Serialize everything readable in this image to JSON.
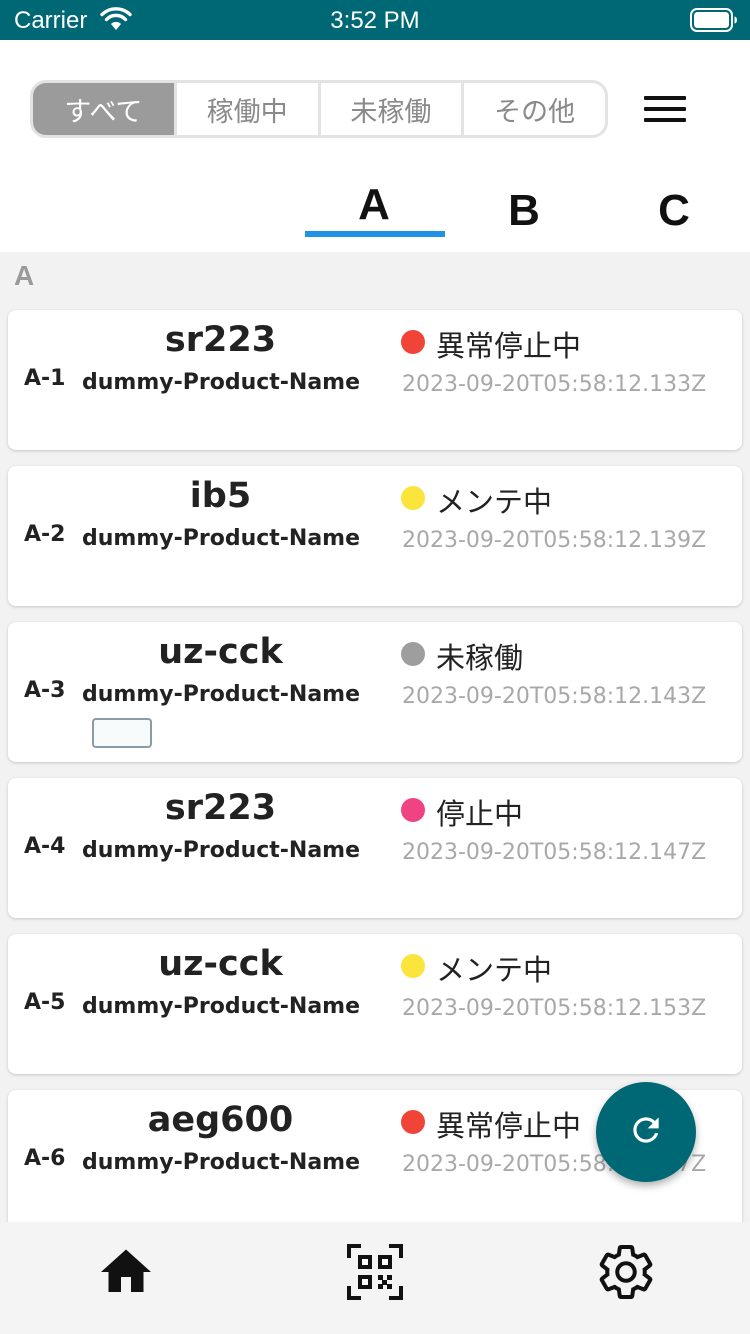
{
  "status_bar": {
    "carrier": "Carrier",
    "time": "3:52 PM",
    "icons": [
      "wifi-icon",
      "battery-icon"
    ]
  },
  "filter": {
    "segments": [
      "すべて",
      "稼働中",
      "未稼働",
      "その他"
    ],
    "selected": "すべて",
    "menu_icon": "hamburger-menu-icon"
  },
  "tabs": {
    "items": [
      "A",
      "B",
      "C"
    ],
    "selected": "A",
    "underline_color": "#2191e6"
  },
  "list": {
    "section_title": "A",
    "cards": [
      {
        "code": "A-1",
        "name": "sr223",
        "product": "dummy-Product-Name",
        "status": "異常停止中",
        "status_color": "#f04438",
        "timestamp": "2023-09-20T05:58:12.133Z"
      },
      {
        "code": "A-2",
        "name": "ib5",
        "product": "dummy-Product-Name",
        "status": "メンテ中",
        "status_color": "#fbe43b",
        "timestamp": "2023-09-20T05:58:12.139Z"
      },
      {
        "code": "A-3",
        "name": "uz-cck",
        "product": "dummy-Product-Name",
        "status": "未稼働",
        "status_color": "#9e9e9e",
        "timestamp": "2023-09-20T05:58:12.143Z"
      },
      {
        "code": "A-4",
        "name": "sr223",
        "product": "dummy-Product-Name",
        "status": "停止中",
        "status_color": "#ef4383",
        "timestamp": "2023-09-20T05:58:12.147Z"
      },
      {
        "code": "A-5",
        "name": "uz-cck",
        "product": "dummy-Product-Name",
        "status": "メンテ中",
        "status_color": "#fbe43b",
        "timestamp": "2023-09-20T05:58:12.153Z"
      },
      {
        "code": "A-6",
        "name": "aeg600",
        "product": "dummy-Product-Name",
        "status": "異常停止中",
        "status_color": "#f04438",
        "timestamp": "2023-09-20T05:58:12.157Z"
      }
    ]
  },
  "fab": {
    "icon": "refresh-icon",
    "color": "#006874"
  },
  "bottom_nav": {
    "items": [
      "home-icon",
      "qr-code-scan-icon",
      "settings-gear-icon"
    ]
  },
  "colors": {
    "brand": "#006874",
    "segment_active": "#9b9b9b"
  }
}
